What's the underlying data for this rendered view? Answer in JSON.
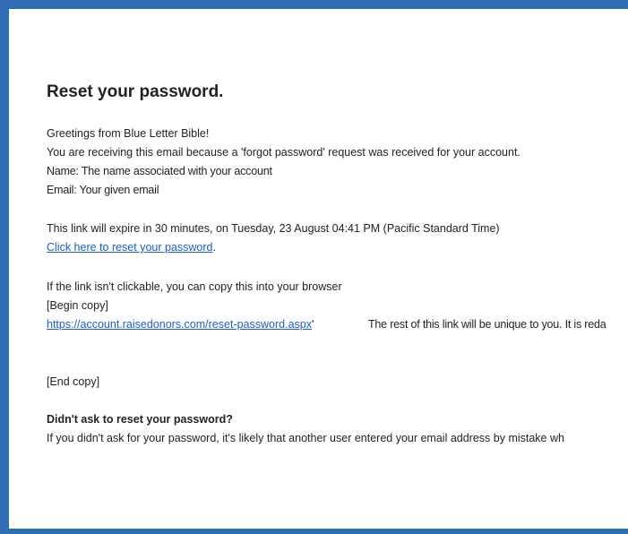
{
  "email": {
    "title": "Reset your password.",
    "greeting": "Greetings from Blue Letter Bible!",
    "reason": "You are receiving this email because a 'forgot password' request was received for your account.",
    "name_line": "Name: The name associated with your account",
    "email_line": "Email: Your given email",
    "expiry": "This link will expire in 30 minutes, on Tuesday, 23 August 04:41 PM (Pacific Standard Time)",
    "reset_link_text": "Click here to reset your password",
    "reset_link_suffix": ".",
    "copy_intro": "If the link isn't clickable, you can copy this into your browser",
    "begin_copy": "[Begin copy]",
    "copy_url": "https://account.raisedonors.com/reset-password.aspx",
    "copy_url_tick": "'",
    "redacted_note": "The rest of this link will be unique to you. It is reda",
    "end_copy": "[End copy]",
    "didnt_ask_heading": "Didn't ask to reset your password?",
    "didnt_ask_body": "If you didn't ask for your password, it's likely that another user entered your email address by mistake wh"
  },
  "colors": {
    "frame_border": "#2f6db4",
    "link": "#1a5fcc",
    "text": "#222222"
  }
}
